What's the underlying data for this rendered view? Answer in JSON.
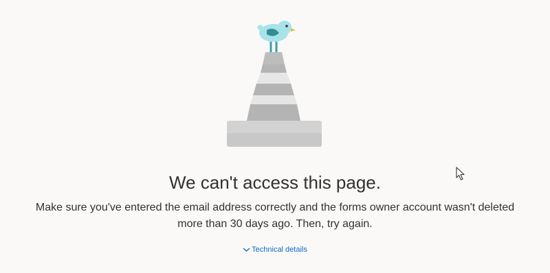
{
  "error": {
    "title": "We can't access this page.",
    "message_line1": "Make sure you've entered the email address correctly and the forms owner account wasn't deleted",
    "message_line2": "more than 30 days ago. Then, try again.",
    "technical_details_label": "Technical details"
  },
  "icons": {
    "illustration": "traffic-cone-with-bird",
    "expand": "chevron-down-icon",
    "cursor": "mouse-pointer-icon"
  },
  "colors": {
    "background": "#faf9f8",
    "text": "#323130",
    "link": "#0f6cbd"
  }
}
